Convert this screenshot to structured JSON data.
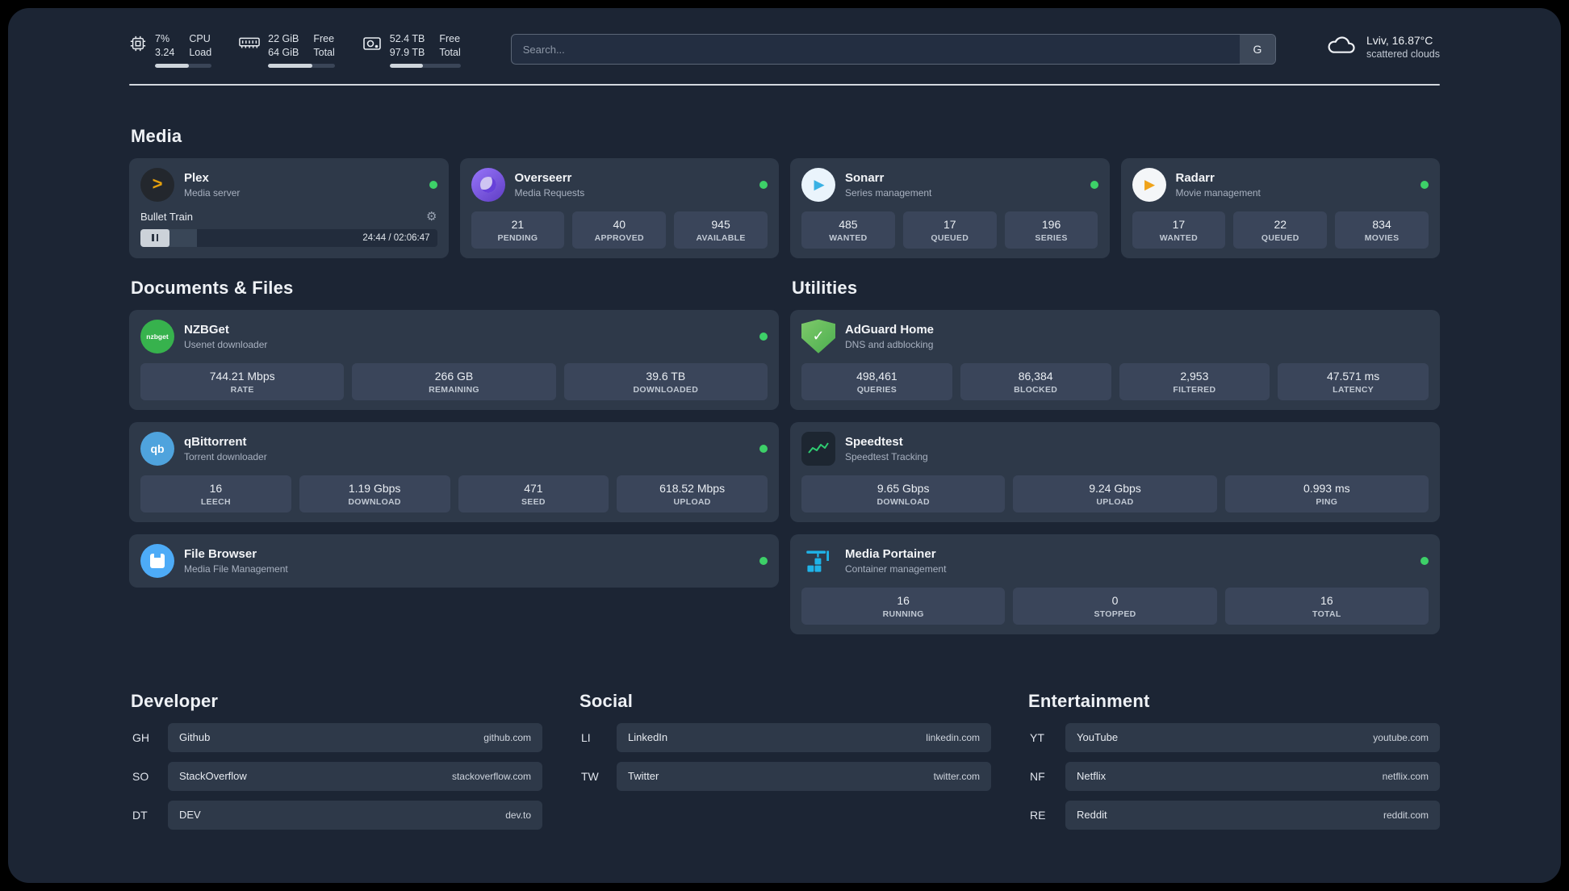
{
  "colors": {
    "background": "#1c2534",
    "card": "#2e3949",
    "stat_tile": "#3a455a",
    "status_online_green": "#3dd068",
    "plex_gold": "#e5a00d",
    "divider": "#e8ecf1"
  },
  "topbar": {
    "stats": [
      {
        "icon": "cpu-icon",
        "col1": [
          "7%",
          "3.24"
        ],
        "col2": [
          "CPU",
          "Load"
        ],
        "progress": 60
      },
      {
        "icon": "ram-icon",
        "col1": [
          "22 GiB",
          "64 GiB"
        ],
        "col2": [
          "Free",
          "Total"
        ],
        "progress": 66
      },
      {
        "icon": "hdd-icon",
        "col1": [
          "52.4 TB",
          "97.9 TB"
        ],
        "col2": [
          "Free",
          "Total"
        ],
        "progress": 47
      }
    ],
    "search": {
      "placeholder": "Search...",
      "button_label": "G"
    },
    "weather": {
      "icon": "cloud-icon",
      "location": "Lviv, 16.87°C",
      "condition": "scattered clouds"
    }
  },
  "sections": {
    "media": {
      "title": "Media",
      "cards": [
        {
          "name": "Plex",
          "subtitle": "Media server",
          "icon": "plex-icon",
          "online": true,
          "player": {
            "track_title": "Bullet Train",
            "time": "24:44 / 02:06:47",
            "progress": 19
          }
        },
        {
          "name": "Overseerr",
          "subtitle": "Media Requests",
          "icon": "overseerr-icon",
          "online": true,
          "stats": [
            {
              "value": "21",
              "label": "PENDING"
            },
            {
              "value": "40",
              "label": "APPROVED"
            },
            {
              "value": "945",
              "label": "AVAILABLE"
            }
          ]
        },
        {
          "name": "Sonarr",
          "subtitle": "Series management",
          "icon": "sonarr-icon",
          "online": true,
          "stats": [
            {
              "value": "485",
              "label": "WANTED"
            },
            {
              "value": "17",
              "label": "QUEUED"
            },
            {
              "value": "196",
              "label": "SERIES"
            }
          ]
        },
        {
          "name": "Radarr",
          "subtitle": "Movie management",
          "icon": "radarr-icon",
          "online": true,
          "stats": [
            {
              "value": "17",
              "label": "WANTED"
            },
            {
              "value": "22",
              "label": "QUEUED"
            },
            {
              "value": "834",
              "label": "MOVIES"
            }
          ]
        }
      ]
    },
    "documents": {
      "title": "Documents & Files",
      "cards": [
        {
          "name": "NZBGet",
          "subtitle": "Usenet downloader",
          "icon": "nzbget-icon",
          "online": true,
          "stats": [
            {
              "value": "744.21 Mbps",
              "label": "RATE"
            },
            {
              "value": "266 GB",
              "label": "REMAINING"
            },
            {
              "value": "39.6 TB",
              "label": "DOWNLOADED"
            }
          ]
        },
        {
          "name": "qBittorrent",
          "subtitle": "Torrent downloader",
          "icon": "qbittorrent-icon",
          "online": true,
          "stats": [
            {
              "value": "16",
              "label": "LEECH"
            },
            {
              "value": "1.19 Gbps",
              "label": "DOWNLOAD"
            },
            {
              "value": "471",
              "label": "SEED"
            },
            {
              "value": "618.52 Mbps",
              "label": "UPLOAD"
            }
          ]
        },
        {
          "name": "File Browser",
          "subtitle": "Media File Management",
          "icon": "filebrowser-icon",
          "online": true,
          "stats": []
        }
      ]
    },
    "utilities": {
      "title": "Utilities",
      "cards": [
        {
          "name": "AdGuard Home",
          "subtitle": "DNS and adblocking",
          "icon": "adguard-icon",
          "online": false,
          "stats": [
            {
              "value": "498,461",
              "label": "QUERIES"
            },
            {
              "value": "86,384",
              "label": "BLOCKED"
            },
            {
              "value": "2,953",
              "label": "FILTERED"
            },
            {
              "value": "47.571 ms",
              "label": "LATENCY"
            }
          ]
        },
        {
          "name": "Speedtest",
          "subtitle": "Speedtest Tracking",
          "icon": "speedtest-icon",
          "online": false,
          "stats": [
            {
              "value": "9.65 Gbps",
              "label": "DOWNLOAD"
            },
            {
              "value": "9.24 Gbps",
              "label": "UPLOAD"
            },
            {
              "value": "0.993 ms",
              "label": "PING"
            }
          ]
        },
        {
          "name": "Media Portainer",
          "subtitle": "Container management",
          "icon": "portainer-icon",
          "online": true,
          "stats": [
            {
              "value": "16",
              "label": "RUNNING"
            },
            {
              "value": "0",
              "label": "STOPPED"
            },
            {
              "value": "16",
              "label": "TOTAL"
            }
          ]
        }
      ]
    },
    "bookmarks": [
      {
        "title": "Developer",
        "items": [
          {
            "abbr": "GH",
            "name": "Github",
            "url": "github.com"
          },
          {
            "abbr": "SO",
            "name": "StackOverflow",
            "url": "stackoverflow.com"
          },
          {
            "abbr": "DT",
            "name": "DEV",
            "url": "dev.to"
          }
        ]
      },
      {
        "title": "Social",
        "items": [
          {
            "abbr": "LI",
            "name": "LinkedIn",
            "url": "linkedin.com"
          },
          {
            "abbr": "TW",
            "name": "Twitter",
            "url": "twitter.com"
          }
        ]
      },
      {
        "title": "Entertainment",
        "items": [
          {
            "abbr": "YT",
            "name": "YouTube",
            "url": "youtube.com"
          },
          {
            "abbr": "NF",
            "name": "Netflix",
            "url": "netflix.com"
          },
          {
            "abbr": "RE",
            "name": "Reddit",
            "url": "reddit.com"
          }
        ]
      }
    ]
  }
}
